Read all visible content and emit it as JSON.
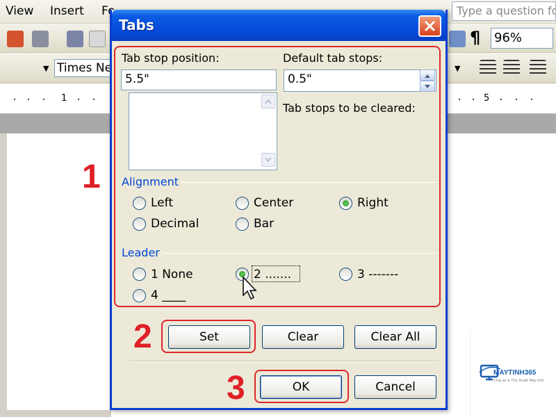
{
  "word": {
    "menu": [
      "View",
      "Insert",
      "Fo"
    ],
    "ask_placeholder": "Type a question fo",
    "font_name": "Times New",
    "zoom": "96%",
    "paragraph_mark": "¶",
    "ruler_numbers": [
      "1",
      "5"
    ]
  },
  "dialog": {
    "title": "Tabs",
    "tab_stop_position_label": "Tab stop position:",
    "tab_stop_position_value": "5.5\"",
    "default_tab_stops_label": "Default tab stops:",
    "default_tab_stops_value": "0.5\"",
    "to_be_cleared_label": "Tab stops to be cleared:",
    "alignment_title": "Alignment",
    "alignment_options": [
      {
        "label": "Left",
        "checked": false
      },
      {
        "label": "Center",
        "checked": false
      },
      {
        "label": "Right",
        "checked": true
      },
      {
        "label": "Decimal",
        "checked": false
      },
      {
        "label": "Bar",
        "checked": false
      }
    ],
    "leader_title": "Leader",
    "leader_options": [
      {
        "label": "1 None",
        "checked": false
      },
      {
        "label": "2 .......",
        "checked": true
      },
      {
        "label": "3 -------",
        "checked": false
      },
      {
        "label": "4 ____",
        "checked": false
      }
    ],
    "buttons": {
      "set": "Set",
      "clear": "Clear",
      "clear_all": "Clear All",
      "ok": "OK",
      "cancel": "Cancel"
    }
  },
  "annotations": {
    "step1": "1",
    "step2": "2",
    "step3": "3",
    "color": "#e0262b"
  },
  "logo": {
    "brand": "MAYTINH365",
    "tagline": "Chia sẻ & Thủ thuật Máy tính"
  }
}
